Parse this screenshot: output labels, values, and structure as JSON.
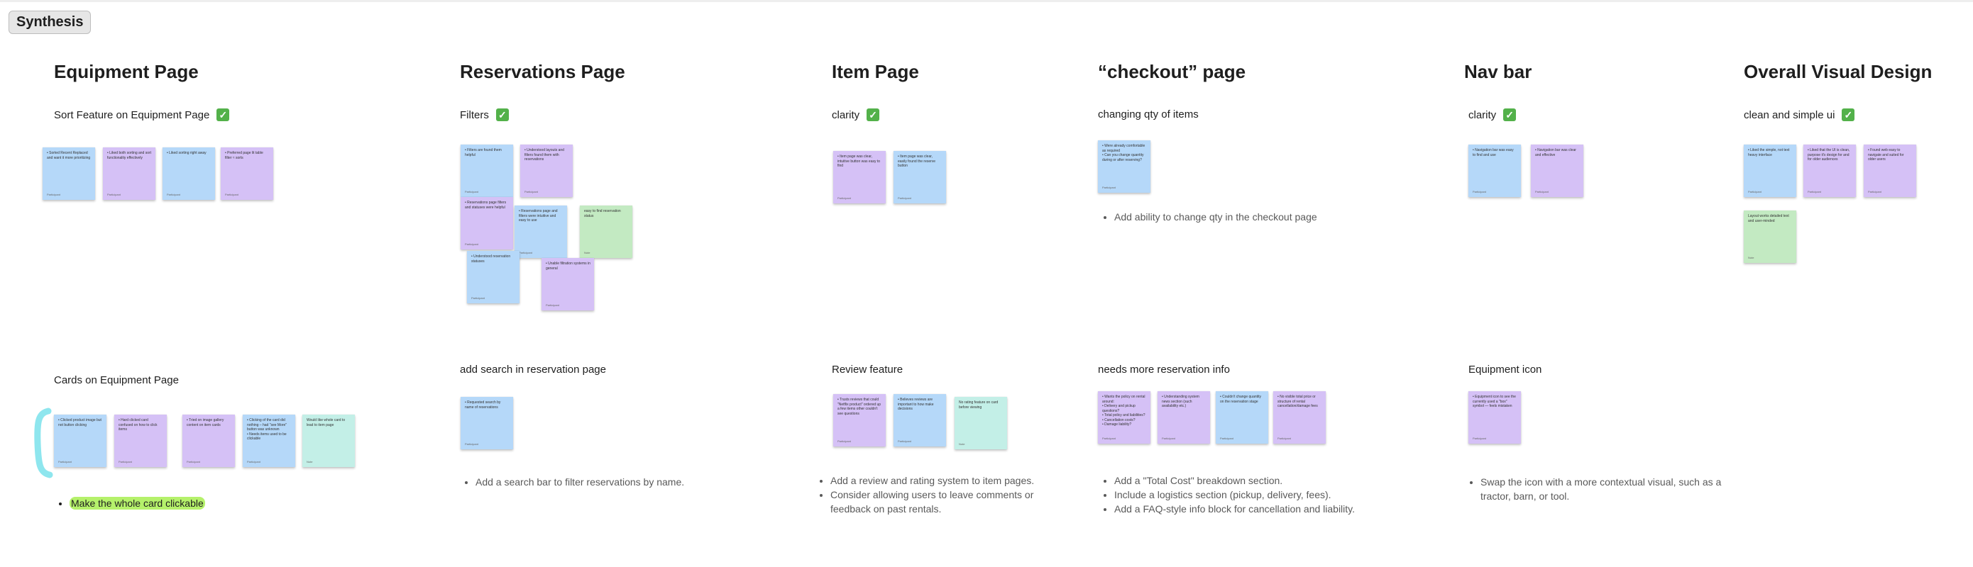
{
  "frame": {
    "label": "Synthesis"
  },
  "sections": {
    "equipment": {
      "title": "Equipment Page",
      "sort": {
        "label": "Sort Feature on Equipment Page",
        "check": "✓"
      },
      "cards": {
        "label": "Cards on Equipment Page",
        "bullets": [
          "Make the whole card clickable"
        ]
      },
      "sort_notes": [
        {
          "text": "• Sorted Recent Replaced and want it more prioritizing",
          "author": "Participant"
        },
        {
          "text": "• Liked both sorting and sort functionality effectively",
          "author": "Participant"
        },
        {
          "text": "• Liked sorting right away",
          "author": "Participant"
        },
        {
          "text": "• Preferred page lit table filter ≈ sorts",
          "author": "Participant"
        }
      ],
      "card_notes": [
        {
          "text": "• Clicked product image but not button clicking",
          "author": "Participant"
        },
        {
          "text": "• Hard clicked card confused on how to click items",
          "author": "Participant"
        },
        {
          "text": "• Tried on image gallery content on item cards",
          "author": "Participant"
        },
        {
          "text": "• Clicking of the card did nothing – had \"see More\" button was unknown\n• Needs items used to be clickable",
          "author": "Participant"
        },
        {
          "text": "Would like whole card to lead to item page",
          "author": "Note"
        }
      ]
    },
    "reservations": {
      "title": "Reservations Page",
      "filters": {
        "label": "Filters",
        "check": "✓"
      },
      "search": {
        "label": "add search in reservation page",
        "bullets": [
          "Add a search bar to filter reservations by name."
        ]
      },
      "filter_notes": [
        {
          "text": "• Filters are found them helpful",
          "author": "Participant"
        },
        {
          "text": "• Understood layouts and filters found them with reservations",
          "author": "Participant"
        },
        {
          "text": "• Reservations page filters and statuses were helpful",
          "author": "Participant"
        },
        {
          "text": "• Reservations page and filters were intuitive and easy to use",
          "author": "Participant"
        },
        {
          "text": "easy to find reservation status",
          "author": "Note"
        },
        {
          "text": "• Understood reservation statuses",
          "author": "Participant"
        },
        {
          "text": "• Unable filtration systems in general",
          "author": "Participant"
        }
      ],
      "search_notes": [
        {
          "text": "• Requested search by name of reservations",
          "author": "Participant"
        }
      ]
    },
    "item": {
      "title": "Item Page",
      "clarity": {
        "label": "clarity",
        "check": "✓"
      },
      "review": {
        "label": "Review feature",
        "bullets": [
          "Add a review and rating system to item pages.",
          "Consider allowing users to leave comments or feedback on past rentals."
        ]
      },
      "clarity_notes": [
        {
          "text": "• Item page was clear, intuitive button was easy to find",
          "author": "Participant"
        },
        {
          "text": "• Item page was clear, easily found the reserve button",
          "author": "Participant"
        }
      ],
      "review_notes": [
        {
          "text": "• Trusts reviews that could \"Netflix product\" ordered up a few items other couldn't see questions",
          "author": "Participant"
        },
        {
          "text": "• Believes reviews are important to how make decisions",
          "author": "Participant"
        },
        {
          "text": "No rating feature on card before viewing",
          "author": "Note"
        }
      ]
    },
    "checkout": {
      "title": "“checkout” page",
      "qty": {
        "label": "changing qty of items",
        "bullets": [
          "Add ability to change qty in the checkout page"
        ]
      },
      "info": {
        "label": "needs more reservation info",
        "bullets": [
          "Add a \"Total Cost\" breakdown section.",
          "Include a logistics section (pickup, delivery, fees).",
          "Add a FAQ-style info block for cancellation and liability."
        ]
      },
      "qty_notes": [
        {
          "text": "• Were already comfortable as required\n• Can you change quantity during or after reserving?",
          "author": "Participant"
        }
      ],
      "info_notes": [
        {
          "text": "• Wants the policy on rental around:\n• Delivery and pickup questions?\n• Total policy and liabilities?\n• Cancellation costs?\n• Damage liability?",
          "author": "Participant"
        },
        {
          "text": "• Understanding system news section (such availability etc.)",
          "author": "Participant"
        },
        {
          "text": "• Couldn't change quantity on the reservation stage",
          "author": "Participant"
        },
        {
          "text": "• No visible total price or structure of rental cancellation/damage fees",
          "author": "Participant"
        }
      ]
    },
    "nav": {
      "title": "Nav bar",
      "clarity": {
        "label": "clarity",
        "check": "✓"
      },
      "icon": {
        "label": "Equipment icon",
        "bullets": [
          "Swap the icon with a more contextual visual, such as a tractor, barn, or tool."
        ]
      },
      "clarity_notes": [
        {
          "text": "• Navigation bar was easy to find and use",
          "author": "Participant"
        },
        {
          "text": "• Navigation bar was clear and effective",
          "author": "Participant"
        }
      ],
      "icon_notes": [
        {
          "text": "• Equipment icon to see the currently used a \"box\" symbol — feels mistaken",
          "author": "Participant"
        }
      ]
    },
    "visual": {
      "title": "Overall Visual Design",
      "clean": {
        "label": "clean and simple ui",
        "check": "✓"
      },
      "notes": [
        {
          "text": "• Liked the simple, not text heavy interface",
          "author": "Participant"
        },
        {
          "text": "• Liked that the UI is clean, purpose it's design for and for older audiences",
          "author": "Participant"
        },
        {
          "text": "• Found web easy to navigate and suited for older users",
          "author": "Participant"
        },
        {
          "text": "Layout works detailed text and user-minded",
          "author": "Note"
        }
      ]
    }
  },
  "colors": {
    "note_blue": "#b5d8f9",
    "note_purple": "#d5c1f6",
    "note_green": "#c3eac2",
    "note_teal": "#c3efe7",
    "highlight": "#b5f16b",
    "check_green": "#53b14a"
  }
}
